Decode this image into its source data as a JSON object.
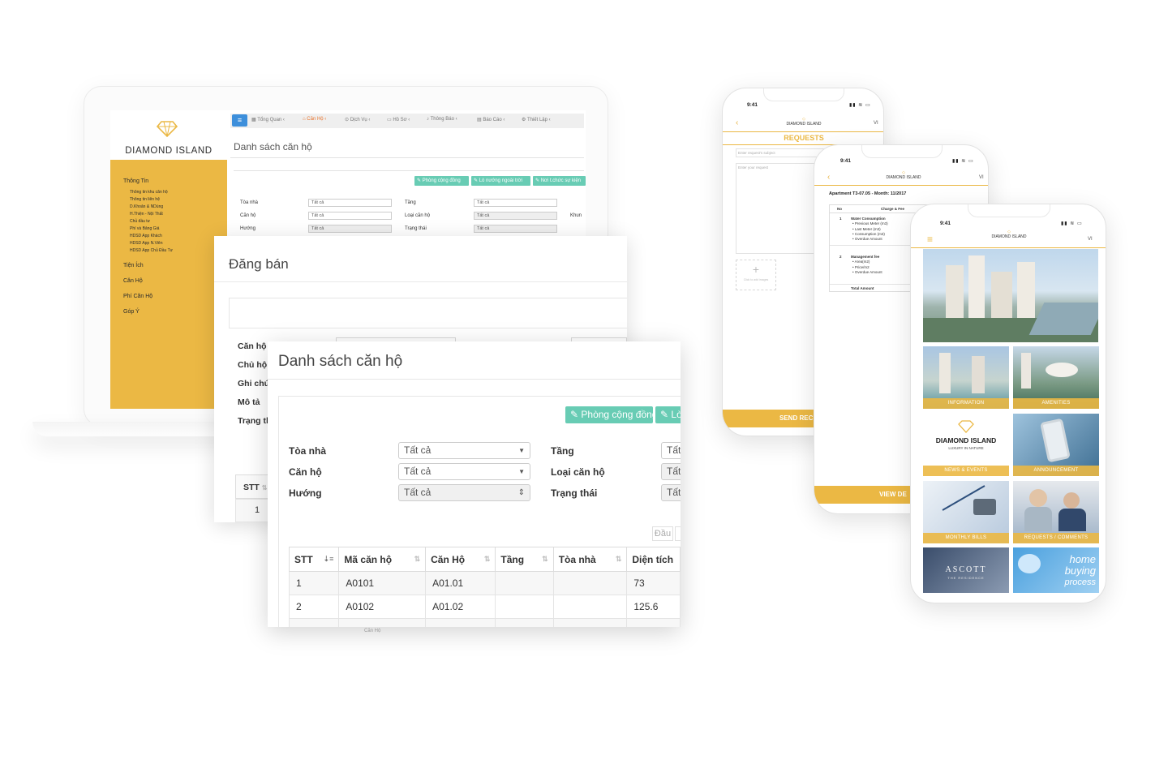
{
  "web": {
    "brand": "DIAMOND ISLAND",
    "nav": [
      "Tổng Quan ‹",
      "Căn Hộ ‹",
      "Dịch Vụ ‹",
      "Hồ Sơ ‹",
      "Thông Báo ‹",
      "Báo Cáo ‹",
      "Thiết Lập ‹"
    ],
    "page_title": "Danh sách căn hộ",
    "sidebar": {
      "section1": "Thông Tin",
      "sub": [
        "Thông tin khu căn hộ",
        "Thông tin liên hệ",
        "D.Khoản & NDùng",
        "H.Thiện - Nội Thất",
        "Chủ đầu tư",
        "Phí và Bảng Giá",
        "HDSD App Khách",
        "HDSD App N.Viên",
        "HDSD App Chủ Đầu Tư"
      ],
      "others": [
        "Tiện Ích",
        "Căn Hộ",
        "Phí Căn Hộ",
        "Góp Ý"
      ]
    },
    "buttons": [
      "✎ Phòng cộng đồng",
      "✎ Lò nướng ngoài trời",
      "✎ Nơi t.chức sự kiện"
    ],
    "filters": {
      "toa_nha": "Tòa nhà",
      "can_ho": "Căn hộ",
      "huong": "Hướng",
      "tang": "Tầng",
      "loai_can_ho": "Loại căn hộ",
      "trang_thai": "Trạng thái",
      "khun": "Khun",
      "all": "Tất cả"
    }
  },
  "dang_ban": {
    "title": "Đăng bán",
    "labels": [
      "Căn hộ",
      "Chủ hộ",
      "Ghi chú",
      "Mô tả",
      "Trạng th"
    ],
    "stt": "STT",
    "row1": "1"
  },
  "danh_sach": {
    "title": "Danh sách căn hộ",
    "buttons": [
      "✎ Phòng cộng đồng",
      "✎ Lò"
    ],
    "labels_left": [
      "Tòa nhà",
      "Căn hộ",
      "Hướng"
    ],
    "labels_right": [
      "Tầng",
      "Loại căn hộ",
      "Trạng thái"
    ],
    "select_value": "Tất cả",
    "select_cut": "Tất",
    "pager": "Đầu",
    "columns": [
      "STT",
      "Mã căn hộ",
      "Căn Hộ",
      "Tầng",
      "Tòa nhà",
      "Diện tích"
    ],
    "rows": [
      [
        "1",
        "A0101",
        "A01.01",
        "",
        "",
        "73"
      ],
      [
        "2",
        "A0102",
        "A01.02",
        "",
        "",
        "125.6"
      ]
    ],
    "stray_label": "Căn Hộ"
  },
  "phone_requests": {
    "time": "9:41",
    "title": "REQUESTS",
    "subject_ph": "Enter request's subject",
    "body_ph": "Enter your request",
    "add_hint": "Click to add images",
    "button": "SEND REC",
    "lang": "VI"
  },
  "phone_bill": {
    "time": "9:41",
    "lang": "VI",
    "heading": "Apartment T3-07.05 - Month: 11/2017",
    "col_no": "No",
    "col_charge": "Charge & Fee",
    "groups": [
      {
        "no": "1",
        "name": "Water Consumption",
        "items": [
          "• Previous Meter (m3)",
          "• Last Meter (m3)",
          "• Consumption (m3)",
          "• Overdue Amount"
        ]
      },
      {
        "no": "2",
        "name": "Management fee",
        "items": [
          "• Area(m2)",
          "• Price/m2",
          "• Overdue Amount"
        ]
      }
    ],
    "total": "Total Amount",
    "button": "VIEW DE"
  },
  "phone_home": {
    "time": "9:41",
    "lang": "VI",
    "brand": "DIAMOND ISLAND",
    "tagline": "LUXURY IN NATURE",
    "tiles": [
      "INFORMATION",
      "AMENITIES",
      "NEWS & EVENTS",
      "ANNOUNCEMENT",
      "MONTHLY BILLS",
      "REQUESTS / COMMENTS"
    ],
    "ascott": "ASCOTT",
    "ascott_sub": "THE RESIDENCE",
    "home_text": [
      "home",
      "buying",
      "process"
    ]
  },
  "colors": {
    "gold": "#ebb844",
    "teal": "#68ccb4",
    "blue": "#3d8fdb"
  }
}
